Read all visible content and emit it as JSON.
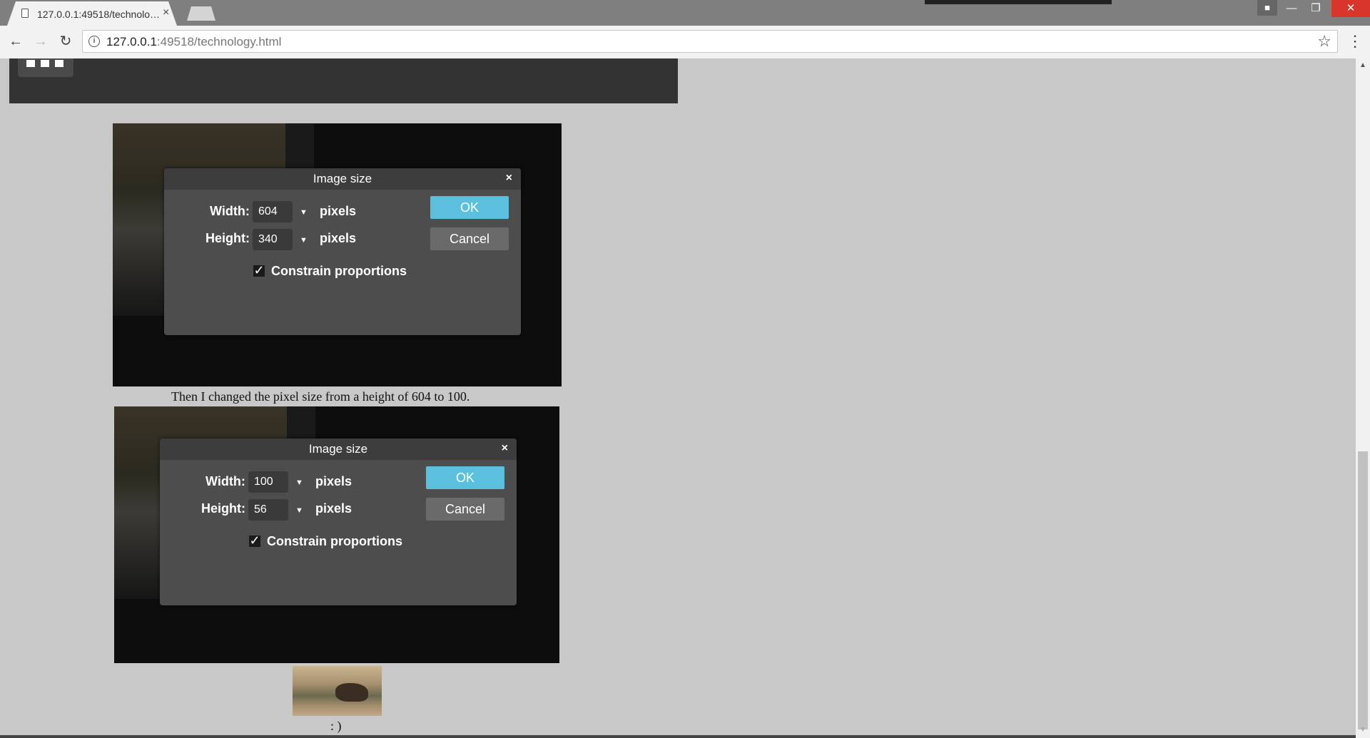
{
  "browser": {
    "tab_title": "127.0.0.1:49518/technology.html",
    "tab_close": "×",
    "url_host": "127.0.0.1",
    "url_rest": ":49518/technology.html",
    "window_controls": {
      "minimize": "—",
      "maximize": "❐",
      "close": "✕"
    },
    "icons": {
      "back": "arrow-left-icon",
      "forward": "arrow-right-icon",
      "reload": "reload-icon",
      "info": "info-icon",
      "star": "star-icon",
      "menu": "kebab-menu-icon"
    }
  },
  "page": {
    "dialog1": {
      "title": "Image size",
      "close": "×",
      "width_label": "Width:",
      "width_value": "604",
      "height_label": "Height:",
      "height_value": "340",
      "unit": "pixels",
      "ok": "OK",
      "cancel": "Cancel",
      "checkbox_mark": "✓",
      "constrain_label": "Constrain proportions",
      "constrain_checked": true
    },
    "caption": "Then I changed the pixel size from a height of 604 to 100.",
    "dialog2": {
      "title": "Image size",
      "close": "×",
      "width_label": "Width:",
      "width_value": "100",
      "height_label": "Height:",
      "height_value": "56",
      "unit": "pixels",
      "ok": "OK",
      "cancel": "Cancel",
      "checkbox_mark": "✓",
      "constrain_label": "Constrain proportions",
      "constrain_checked": true
    },
    "smiley": ": )"
  },
  "colors": {
    "page_bg": "#c8c8c8",
    "dialog_bg": "#4d4d4d",
    "ok_button": "#5bc0de",
    "cancel_button": "#6a6a6a",
    "close_window": "#d9352a"
  }
}
